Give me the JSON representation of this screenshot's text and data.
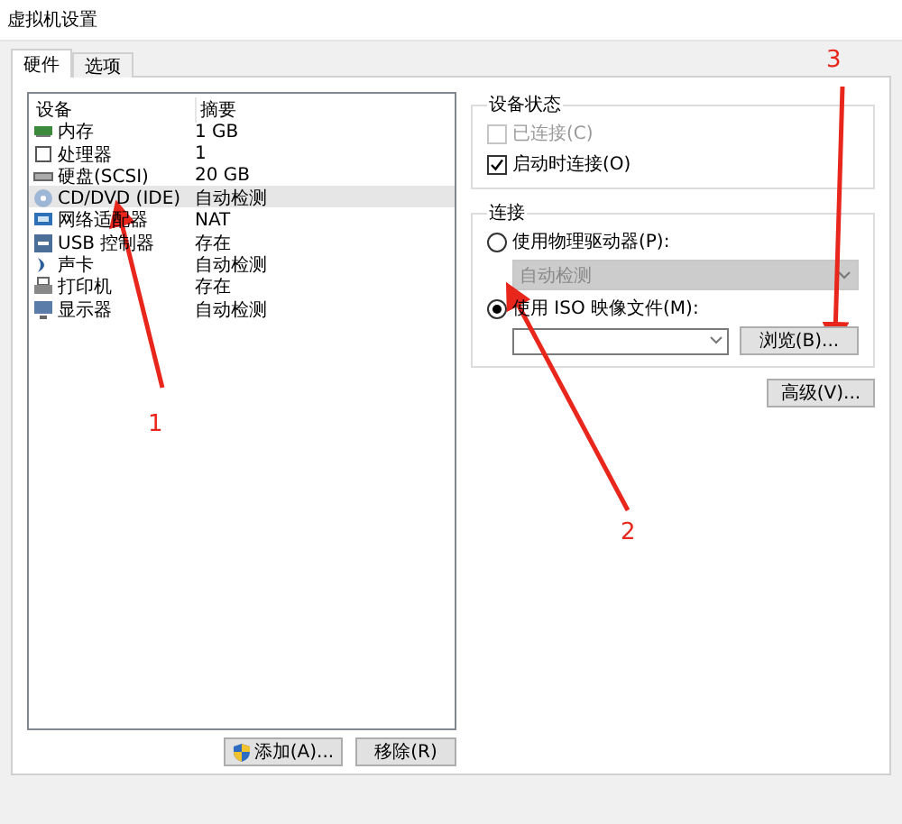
{
  "window": {
    "title": "虚拟机设置"
  },
  "tabs": [
    {
      "label": "硬件",
      "selected": true
    },
    {
      "label": "选项",
      "selected": false
    }
  ],
  "devices": {
    "columns": [
      "设备",
      "摘要"
    ],
    "rows": [
      {
        "kind": "memory",
        "name": "内存",
        "summary": "1 GB",
        "selected": false
      },
      {
        "kind": "cpu",
        "name": "处理器",
        "summary": "1",
        "selected": false
      },
      {
        "kind": "disk",
        "name": "硬盘(SCSI)",
        "summary": "20 GB",
        "selected": false
      },
      {
        "kind": "cd",
        "name": "CD/DVD (IDE)",
        "summary": "自动检测",
        "selected": true
      },
      {
        "kind": "network",
        "name": "网络适配器",
        "summary": "NAT",
        "selected": false
      },
      {
        "kind": "usb",
        "name": "USB 控制器",
        "summary": "存在",
        "selected": false
      },
      {
        "kind": "sound",
        "name": "声卡",
        "summary": "自动检测",
        "selected": false
      },
      {
        "kind": "printer",
        "name": "打印机",
        "summary": "存在",
        "selected": false
      },
      {
        "kind": "display",
        "name": "显示器",
        "summary": "自动检测",
        "selected": false
      }
    ]
  },
  "list_buttons": [
    {
      "label": "添加(A)...",
      "shield": true
    },
    {
      "label": "移除(R)",
      "shield": false
    }
  ],
  "device_status": {
    "title": "设备状态",
    "options": [
      {
        "label": "已连接(C)",
        "checked": false,
        "disabled": true
      },
      {
        "label": "启动时连接(O)",
        "checked": true,
        "disabled": false
      }
    ]
  },
  "connection": {
    "title": "连接",
    "physical": {
      "label": "使用物理驱动器(P):",
      "selected": false,
      "drive": "自动检测"
    },
    "iso": {
      "label": "使用 ISO 映像文件(M):",
      "selected": true,
      "browse": "浏览(B)..."
    }
  },
  "advanced_button": "高级(V)...",
  "annotations": [
    {
      "label": "1"
    },
    {
      "label": "2"
    },
    {
      "label": "3"
    }
  ]
}
